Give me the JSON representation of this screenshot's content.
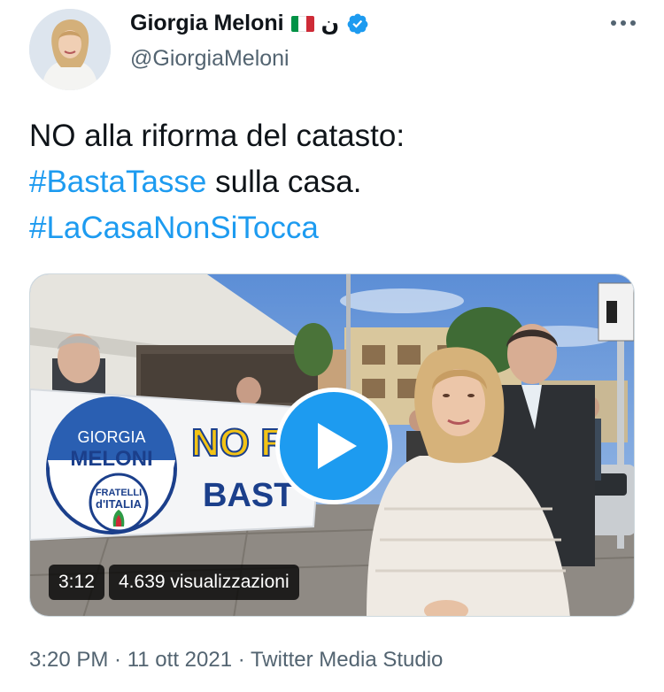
{
  "author": {
    "display_name": "Giorgia Meloni",
    "arabic_glyph": "ن",
    "handle": "@GiorgiaMeloni",
    "flag_colors": [
      "#009246",
      "#ffffff",
      "#ce2b37"
    ],
    "verified_color": "#1d9bf0"
  },
  "tweet": {
    "text_line1": "NO alla riforma del catasto:",
    "hashtag1": "#BastaTasse",
    "text_line2_rest": " sulla casa.",
    "hashtag2": "#LaCasaNonSiTocca"
  },
  "media": {
    "duration": "3:12",
    "views": "4.639 visualizzazioni",
    "banner": {
      "logo_line1": "GIORGIA",
      "logo_line2": "MELONI",
      "party_line1": "FRATELLI",
      "party_line2": "d'ITALIA",
      "slogan_line1": "NO R",
      "slogan_line2": "BAST"
    }
  },
  "footer": {
    "time": "3:20 PM",
    "separator": " · ",
    "date": "11 ott 2021",
    "source": "Twitter Media Studio"
  },
  "colors": {
    "hashtag": "#1d9bf0",
    "muted": "#536471",
    "text": "#0f1419"
  }
}
